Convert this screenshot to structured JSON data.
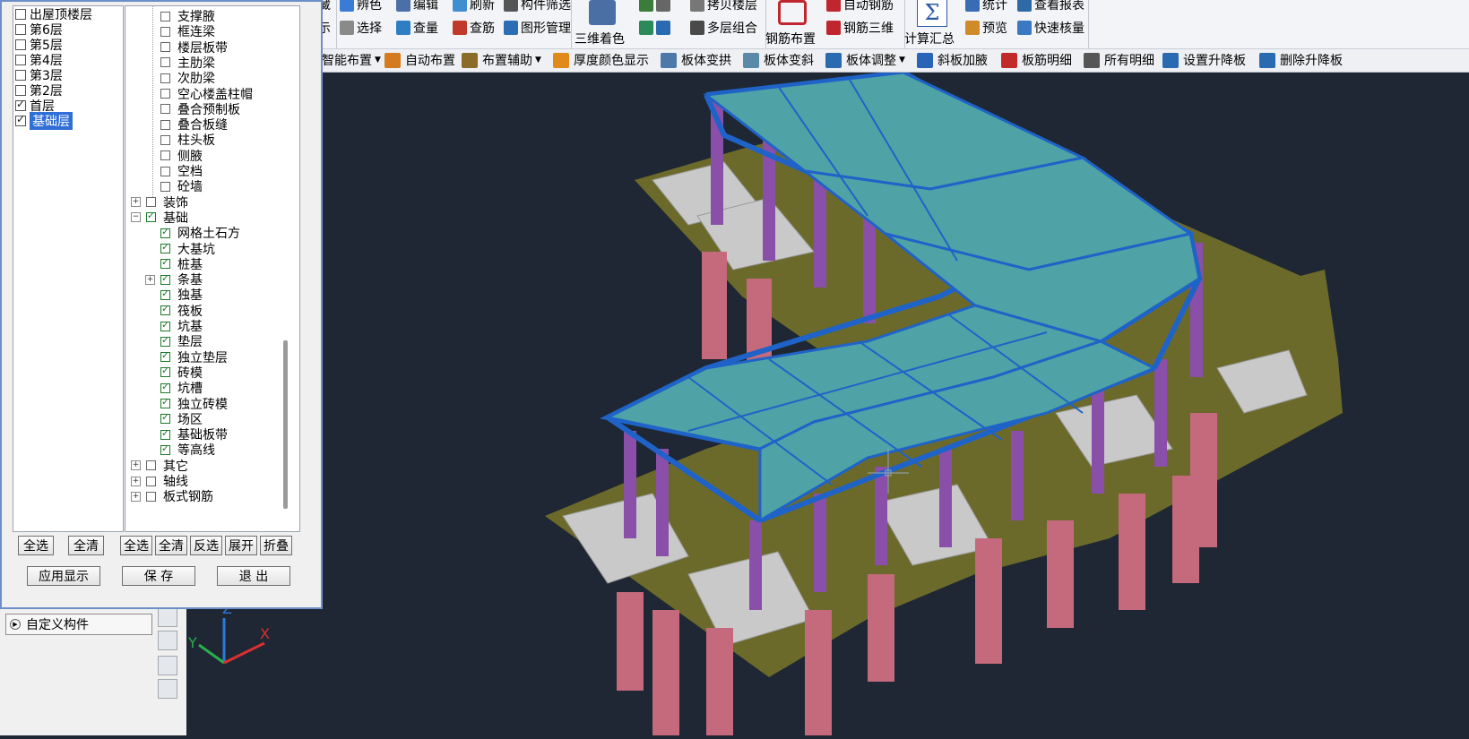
{
  "ribbon": {
    "g1": [
      "藏",
      "示"
    ],
    "g2": {
      "r1": [
        "辨色",
        "编辑",
        "刷新",
        "构件筛选"
      ],
      "r2": [
        "选择",
        "查量",
        "查筋",
        "图形管理"
      ]
    },
    "g3": {
      "big": "三维着色",
      "r1": [
        "拷贝楼层"
      ],
      "r2": [
        "多层组合"
      ]
    },
    "g4": {
      "big": "钢筋布置",
      "r1": "自动钢筋",
      "r2": "钢筋三维"
    },
    "g5": {
      "big": "计算汇总",
      "r1": [
        "统计",
        "查看报表"
      ],
      "r2": [
        "预览",
        "快速核量"
      ]
    }
  },
  "toolbar2": {
    "items": [
      "智能布置",
      "自动布置",
      "布置辅助",
      "厚度颜色显示",
      "板体变拱",
      "板体变斜",
      "板体调整",
      "斜板加腋",
      "板筋明细",
      "所有明细",
      "设置升降板",
      "删除升降板"
    ]
  },
  "floors": [
    {
      "label": "出屋顶楼层",
      "checked": false
    },
    {
      "label": "第6层",
      "checked": false
    },
    {
      "label": "第5层",
      "checked": false
    },
    {
      "label": "第4层",
      "checked": false
    },
    {
      "label": "第3层",
      "checked": false
    },
    {
      "label": "第2层",
      "checked": false
    },
    {
      "label": "首层",
      "checked": true
    },
    {
      "label": "基础层",
      "checked": true
    }
  ],
  "tree": [
    {
      "label": "支撑腋",
      "checked": false
    },
    {
      "label": "框连梁",
      "checked": false
    },
    {
      "label": "楼层板带",
      "checked": false
    },
    {
      "label": "主肋梁",
      "checked": false
    },
    {
      "label": "次肋梁",
      "checked": false
    },
    {
      "label": "空心楼盖柱帽",
      "checked": false
    },
    {
      "label": "叠合预制板",
      "checked": false
    },
    {
      "label": "叠合板缝",
      "checked": false
    },
    {
      "label": "柱头板",
      "checked": false
    },
    {
      "label": "侧腋",
      "checked": false
    },
    {
      "label": "空档",
      "checked": false
    },
    {
      "label": "砼墙",
      "checked": false
    },
    {
      "label": "装饰",
      "checked": false
    },
    {
      "label": "基础",
      "checked": true
    },
    {
      "label": "网格土石方",
      "checked": true
    },
    {
      "label": "大基坑",
      "checked": true
    },
    {
      "label": "桩基",
      "checked": true
    },
    {
      "label": "条基",
      "checked": true
    },
    {
      "label": "独基",
      "checked": true
    },
    {
      "label": "筏板",
      "checked": true
    },
    {
      "label": "坑基",
      "checked": true
    },
    {
      "label": "垫层",
      "checked": true
    },
    {
      "label": "独立垫层",
      "checked": true
    },
    {
      "label": "砖模",
      "checked": true
    },
    {
      "label": "坑槽",
      "checked": true
    },
    {
      "label": "独立砖模",
      "checked": true
    },
    {
      "label": "场区",
      "checked": true
    },
    {
      "label": "基础板带",
      "checked": true
    },
    {
      "label": "等高线",
      "checked": true
    },
    {
      "label": "其它",
      "checked": false
    },
    {
      "label": "轴线",
      "checked": false
    },
    {
      "label": "板式钢筋",
      "checked": false
    }
  ],
  "buttons": {
    "floor_all": "全选",
    "floor_clear": "全清",
    "tree_all": "全选",
    "tree_clear": "全清",
    "tree_invert": "反选",
    "tree_expand": "展开",
    "tree_collapse": "折叠",
    "apply": "应用显示",
    "save": "保 存",
    "exit": "退 出"
  },
  "left_panel": {
    "custom_component": "自定义构件"
  },
  "axis": {
    "x": "X",
    "y": "Y",
    "z": "Z"
  },
  "colors": {
    "viewport_bg": "#1e2733",
    "slab": "#4fa3a6",
    "beam": "#1f63c8",
    "column": "#c46a7c",
    "base": "#6f6b2d"
  }
}
